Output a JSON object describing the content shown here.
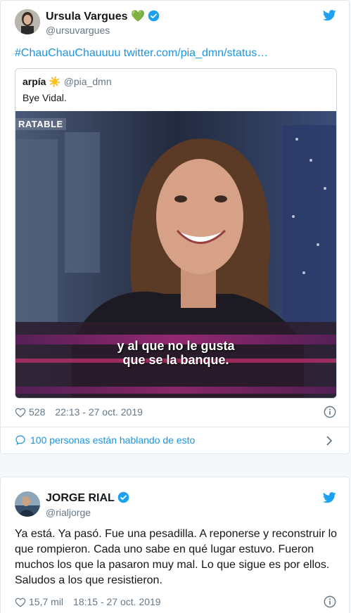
{
  "tweet1": {
    "author_name": "Ursula Vargues",
    "name_emoji": "💚",
    "author_handle": "@ursuvargues",
    "text_hashtag": "#ChauChauChauuuu",
    "text_link": "twitter.com/pia_dmn/status…",
    "quote": {
      "author_name": "arpía",
      "name_emoji": "☀️",
      "author_handle": "@pia_dmn",
      "text": "Bye Vidal.",
      "video": {
        "corner_label": "RATABLE",
        "caption_line1": "y al que no le gusta",
        "caption_line2": "que se la banque."
      }
    },
    "likes": "528",
    "timestamp": "22:13 - 27 oct. 2019",
    "conversation": "100 personas están hablando de esto"
  },
  "tweet2": {
    "author_name": "JORGE RIAL",
    "author_handle": "@rialjorge",
    "text_lines": [
      "Ya está. Ya pasó. Fue una pesadilla. A reponerse y reconstruir lo",
      "que rompieron. Cada uno sabe en qué lugar estuvo. Fueron",
      "muchos los que la pasaron muy mal. Lo que sigue es por ellos.",
      "Saludos a los que resistieron."
    ],
    "likes": "15,7 mil",
    "timestamp": "18:15 - 27 oct. 2019"
  },
  "colors": {
    "twitter_blue": "#1da1f2",
    "link_blue": "#1b95e0",
    "secondary_gray": "#657786",
    "border_gray": "#e1e8ed"
  },
  "icons": [
    "twitter-bird-icon",
    "verified-badge-icon",
    "heart-icon",
    "info-icon",
    "speech-bubble-icon",
    "chevron-right-icon"
  ]
}
